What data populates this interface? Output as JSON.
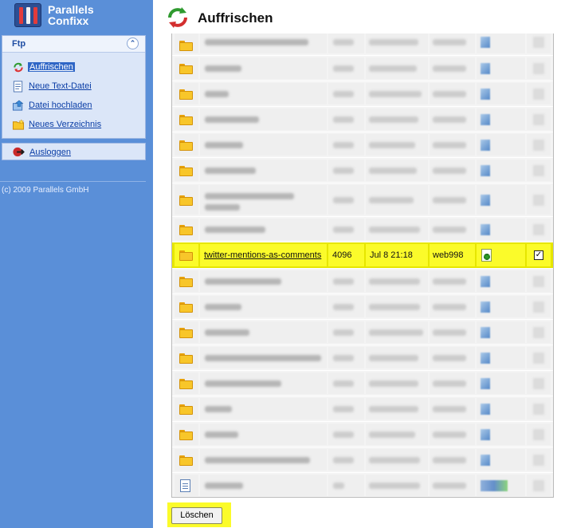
{
  "app": {
    "logo_line1": "Parallels",
    "logo_line2": "Confixx",
    "logo_icon": "confixx-logo-icon"
  },
  "sidebar": {
    "section_title": "Ftp",
    "collapse_icon": "chevron-up-icon",
    "items": [
      {
        "label": "Auffrischen",
        "icon": "refresh-icon",
        "active": true
      },
      {
        "label": "Neue Text-Datei",
        "icon": "new-text-file-icon",
        "active": false
      },
      {
        "label": "Datei hochladen",
        "icon": "upload-file-icon",
        "active": false
      },
      {
        "label": "Neues Verzeichnis",
        "icon": "new-folder-icon",
        "active": false
      }
    ],
    "logout": {
      "label": "Ausloggen",
      "icon": "logout-icon"
    },
    "copyright": "(c) 2009 Parallels GmbH"
  },
  "main": {
    "title": "Auffrischen",
    "title_icon": "refresh-icon"
  },
  "listing": {
    "highlighted_row": {
      "name": "twitter-mentions-as-comments",
      "size": "4096",
      "date": "Jul 8 21:18",
      "owner": "web998",
      "permissions_icon": "file-settings-icon",
      "checked": true,
      "check_mark": "✓"
    }
  },
  "actions": {
    "delete_label": "Löschen"
  },
  "colors": {
    "sidebar": "#5a8fd8",
    "highlight": "#fbfb2a",
    "link": "#0b3ea6"
  }
}
